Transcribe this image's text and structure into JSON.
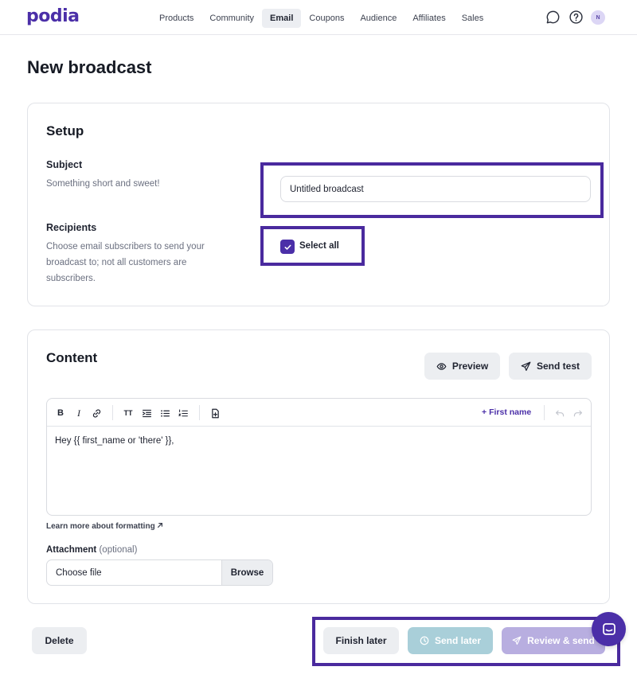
{
  "app": {
    "logo": "podia"
  },
  "nav": {
    "items": [
      {
        "label": "Products",
        "active": false
      },
      {
        "label": "Community",
        "active": false
      },
      {
        "label": "Email",
        "active": true
      },
      {
        "label": "Coupons",
        "active": false
      },
      {
        "label": "Audience",
        "active": false
      },
      {
        "label": "Affiliates",
        "active": false
      },
      {
        "label": "Sales",
        "active": false
      }
    ],
    "avatar_initial": "N"
  },
  "page": {
    "title": "New broadcast"
  },
  "setup": {
    "title": "Setup",
    "subject": {
      "label": "Subject",
      "help": "Something short and sweet!",
      "value": "Untitled broadcast"
    },
    "recipients": {
      "label": "Recipients",
      "help": "Choose email subscribers to send your broadcast to; not all customers are subscribers.",
      "checkbox_label": "Select all",
      "checked": true
    }
  },
  "content": {
    "title": "Content",
    "preview_label": "Preview",
    "send_test_label": "Send test",
    "toolbar": {
      "bold": "B",
      "italic": "I",
      "text_size": "TT",
      "first_name_label": "First name"
    },
    "body_text": "Hey {{ first_name or 'there' }},",
    "learn_more": "Learn more about formatting",
    "attachment": {
      "label": "Attachment",
      "optional": "(optional)",
      "choose_label": "Choose file",
      "browse_label": "Browse"
    }
  },
  "footer": {
    "delete_label": "Delete",
    "finish_later_label": "Finish later",
    "send_later_label": "Send later",
    "review_send_label": "Review & send"
  },
  "colors": {
    "brand": "#4b2fa8",
    "highlight": "#4a2a9e",
    "send_later_bg": "#a9cfd9",
    "review_send_bg": "#b8aee0"
  }
}
